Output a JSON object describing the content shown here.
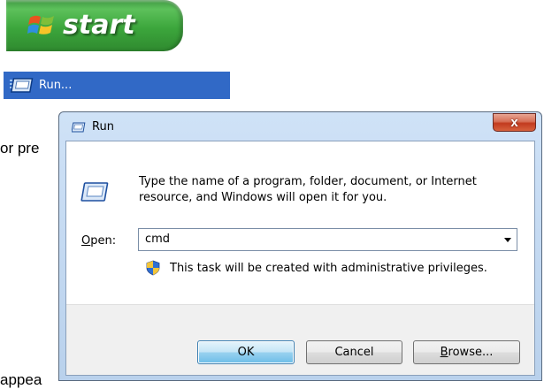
{
  "taskbar": {
    "start_label": "start",
    "flag_icon": "windows-flag-icon"
  },
  "xp_menu": {
    "run_label": "Run...",
    "run_icon": "run-icon"
  },
  "background_text": {
    "fragment_1": "or pre",
    "fragment_2": "appea"
  },
  "dialog": {
    "title": "Run",
    "close_glyph": "x",
    "description": "Type the name of a program, folder, document, or Internet resource, and Windows will open it for you.",
    "open_label_mnemonic": "O",
    "open_label_rest": "pen:",
    "open_value": "cmd",
    "admin_notice": "This task will be created with administrative privileges.",
    "buttons": {
      "ok": "OK",
      "cancel": "Cancel",
      "browse_mnemonic": "B",
      "browse_rest": "rowse..."
    },
    "shield_icon": "uac-shield-icon"
  },
  "colors": {
    "start_green": "#3ca63c",
    "menu_highlight": "#3169c6",
    "close_red": "#c23a1f",
    "ok_blue": "#98d1ef"
  }
}
